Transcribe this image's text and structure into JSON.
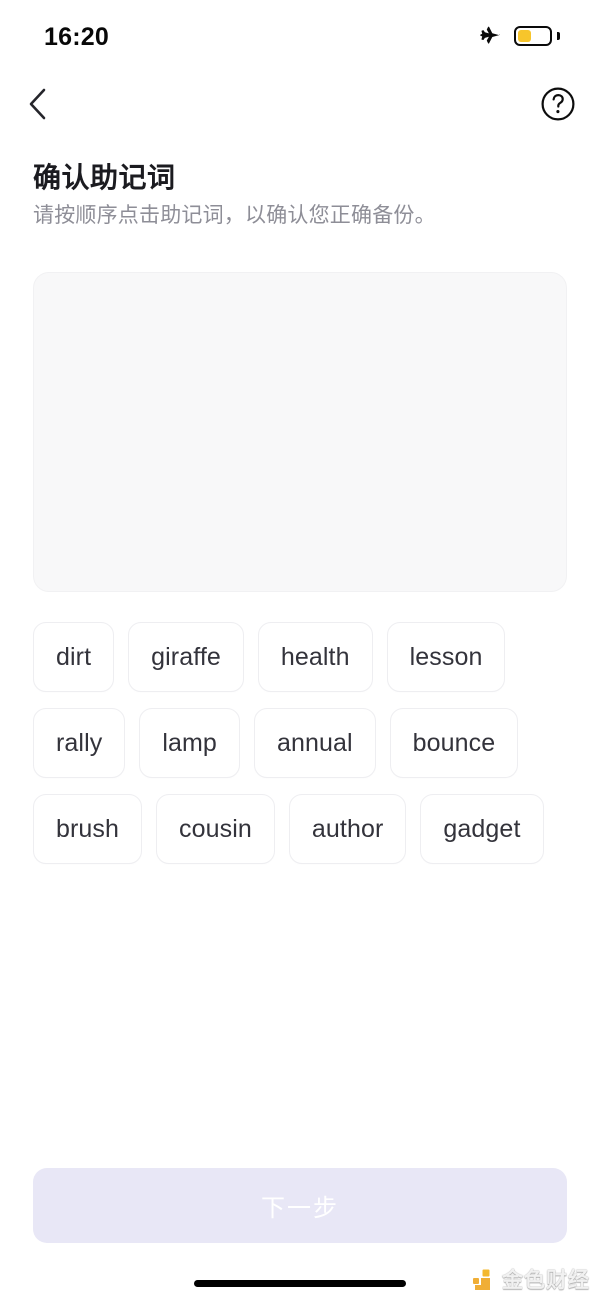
{
  "status_bar": {
    "time": "16:20",
    "airplane_icon": "airplane-icon",
    "battery_icon": "battery-icon",
    "battery_level_percent": 38,
    "battery_fill_color": "#F7C52B"
  },
  "nav": {
    "back_icon": "chevron-left-icon",
    "help_icon": "question-circle-icon"
  },
  "header": {
    "title": "确认助记词",
    "subtitle": "请按顺序点击助记词，以确认您正确备份。"
  },
  "answer_area": {
    "selected_words": [],
    "background_color": "#F8F8F9"
  },
  "word_bank": {
    "words": [
      "dirt",
      "giraffe",
      "health",
      "lesson",
      "rally",
      "lamp",
      "annual",
      "bounce",
      "brush",
      "cousin",
      "author",
      "gadget"
    ]
  },
  "footer": {
    "next_label": "下一步",
    "next_disabled": true,
    "next_background_color": "#E8E7F6"
  },
  "watermark": {
    "text": "金色财经",
    "logo_icon": "jinse-logo-icon",
    "logo_color": "#EFA826"
  },
  "home_indicator": {
    "icon": "home-indicator"
  }
}
